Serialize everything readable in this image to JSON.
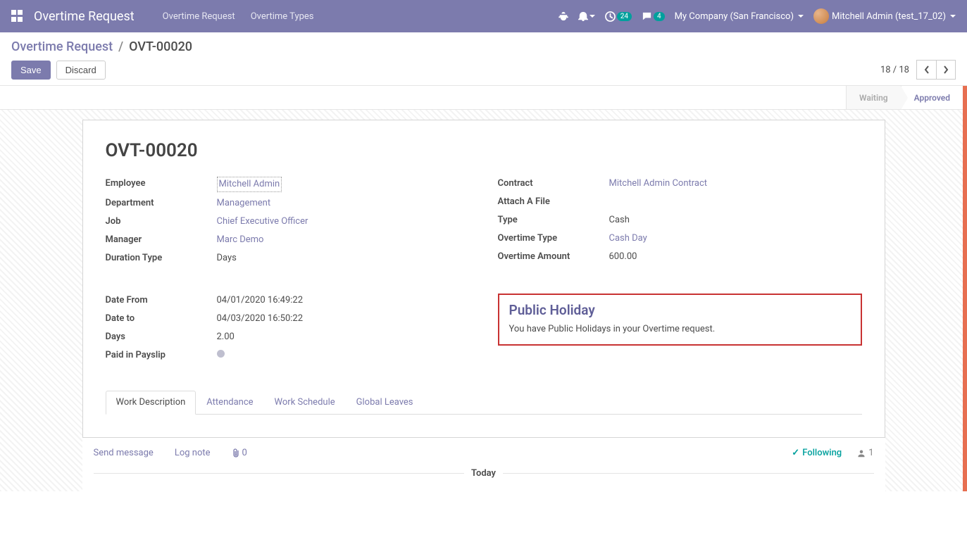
{
  "navbar": {
    "brand": "Overtime Request",
    "menu": [
      "Overtime Request",
      "Overtime Types"
    ],
    "activities_badge": "24",
    "discuss_badge": "4",
    "company": "My Company (San Francisco)",
    "user": "Mitchell Admin (test_17_02)"
  },
  "breadcrumb": {
    "root": "Overtime Request",
    "current": "OVT-00020"
  },
  "buttons": {
    "save": "Save",
    "discard": "Discard"
  },
  "pager": {
    "text": "18 / 18"
  },
  "status": {
    "waiting": "Waiting",
    "approved": "Approved"
  },
  "record": {
    "title": "OVT-00020",
    "left1": {
      "employee_label": "Employee",
      "employee": "Mitchell Admin",
      "department_label": "Department",
      "department": "Management",
      "job_label": "Job",
      "job": "Chief Executive Officer",
      "manager_label": "Manager",
      "manager": "Marc Demo",
      "duration_type_label": "Duration Type",
      "duration_type": "Days"
    },
    "right1": {
      "contract_label": "Contract",
      "contract": "Mitchell Admin Contract",
      "attach_label": "Attach A File",
      "type_label": "Type",
      "type": "Cash",
      "ot_type_label": "Overtime Type",
      "ot_type": "Cash Day",
      "ot_amount_label": "Overtime Amount",
      "ot_amount": "600.00"
    },
    "left2": {
      "date_from_label": "Date From",
      "date_from": "04/01/2020 16:49:22",
      "date_to_label": "Date to",
      "date_to": "04/03/2020 16:50:22",
      "days_label": "Days",
      "days": "2.00",
      "paid_label": "Paid in Payslip"
    },
    "alert": {
      "title": "Public Holiday",
      "body": "You have Public Holidays in your Overtime request."
    }
  },
  "tabs": [
    "Work Description",
    "Attendance",
    "Work Schedule",
    "Global Leaves"
  ],
  "chatter": {
    "send": "Send message",
    "log": "Log note",
    "attach_count": "0",
    "following": "Following",
    "followers": "1",
    "today": "Today"
  }
}
